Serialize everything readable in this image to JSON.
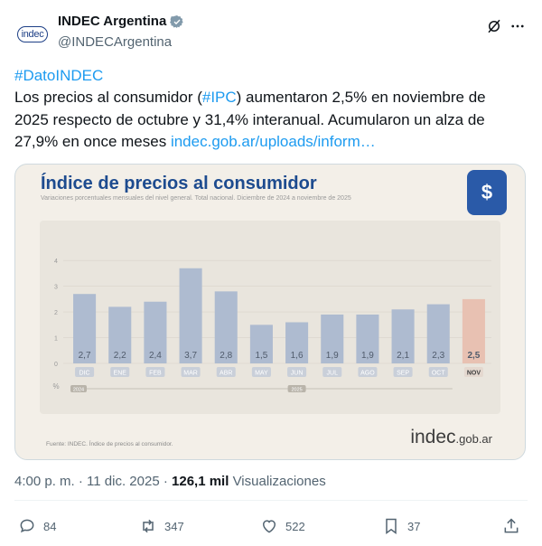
{
  "account": {
    "avatar_text": "indec",
    "name": "INDEC Argentina",
    "handle": "@INDECArgentina"
  },
  "icons": {
    "verified": "verified-badge-icon",
    "grok": "grok-icon",
    "more": "more-icon"
  },
  "tweet": {
    "hashtag": "#DatoINDEC",
    "text_part1": "Los precios al consumidor (",
    "ipc_tag": "#IPC",
    "text_part2": ") aumentaron 2,5% en noviembre de 2025 respecto de octubre y 31,4% interanual. Acumularon un alza de 27,9% en once meses ",
    "link": "indec.gob.ar/uploads/inform…"
  },
  "media": {
    "title": "Índice de precios al consumidor",
    "subtitle": "Variaciones porcentuales mensuales del nivel general. Total nacional. Diciembre de 2024 a noviembre de 2025",
    "source": "Fuente: INDEC. Índice de precios al consumidor.",
    "brand": "indec",
    "brand_suffix": ".gob.ar",
    "logo_symbol": "$"
  },
  "chart_data": {
    "type": "bar",
    "title": "Índice de precios al consumidor",
    "subtitle": "Variaciones porcentuales mensuales del nivel general. Total nacional. Diciembre de 2024 a noviembre de 2025",
    "categories": [
      "DIC",
      "ENE",
      "FEB",
      "MAR",
      "ABR",
      "MAY",
      "JUN",
      "JUL",
      "AGO",
      "SEP",
      "OCT",
      "NOV"
    ],
    "values": [
      2.7,
      2.2,
      2.4,
      3.7,
      2.8,
      1.5,
      1.6,
      1.9,
      1.9,
      2.1,
      2.3,
      2.5
    ],
    "value_labels": [
      "2,7",
      "2,2",
      "2,4",
      "3,7",
      "2,8",
      "1,5",
      "1,6",
      "1,9",
      "1,9",
      "2,1",
      "2,3",
      "2,5"
    ],
    "yticks": [
      "0",
      "1",
      "2",
      "3",
      "4"
    ],
    "ylim": [
      0,
      4.5
    ],
    "ylabel": "%",
    "year_labels": [
      "2024",
      "2025"
    ],
    "colors": {
      "bar": "#aebbd0",
      "highlight": "#e8c1b2",
      "label": "#505b6b"
    }
  },
  "footer": {
    "time": "4:00 p. m.",
    "date": "11 dic. 2025",
    "views_count": "126,1 mil",
    "views_label": "Visualizaciones",
    "replies": "84",
    "reposts": "347",
    "likes": "522",
    "bookmarks": "37"
  }
}
